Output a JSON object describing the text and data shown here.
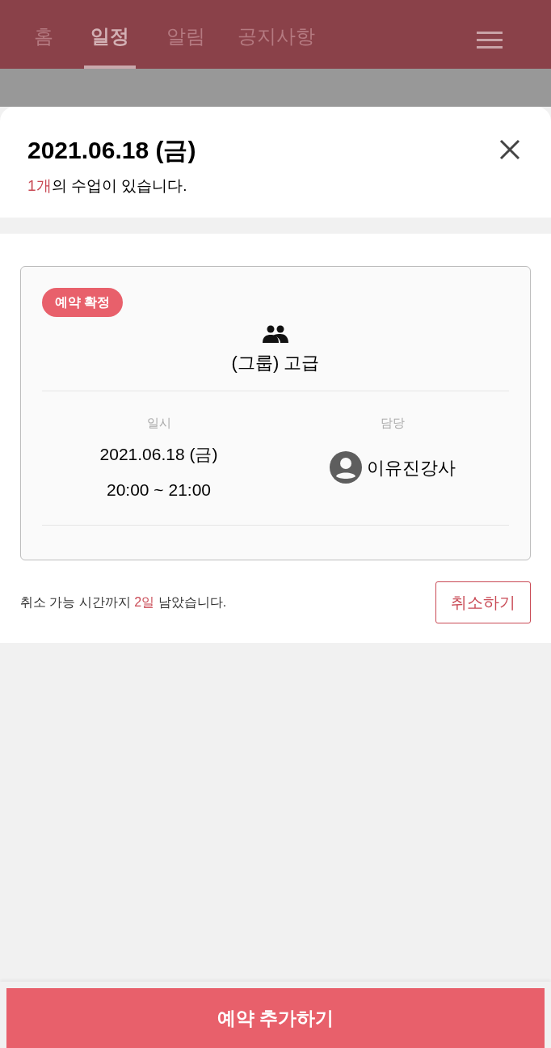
{
  "nav": {
    "tabs": [
      {
        "label": "홈",
        "selected": false
      },
      {
        "label": "일정",
        "selected": true
      },
      {
        "label": "알림",
        "selected": false
      },
      {
        "label": "공지사항",
        "selected": false
      }
    ]
  },
  "sheet": {
    "title": "2021.06.18 (금)",
    "count": "1개",
    "count_suffix": "의 수업이 있습니다.",
    "lesson": {
      "status": "예약 확정",
      "name": "(그룹) 고급",
      "date_label": "일시",
      "date": "2021.06.18 (금)",
      "time": "20:00 ~ 21:00",
      "teacher_label": "담당",
      "teacher": "이유진강사"
    },
    "notice_before": "취소 가능 시간까지 ",
    "notice_days": "2일",
    "notice_after": " 남았습니다.",
    "cancel_button": "취소하기"
  },
  "add_button": "예약 추가하기"
}
